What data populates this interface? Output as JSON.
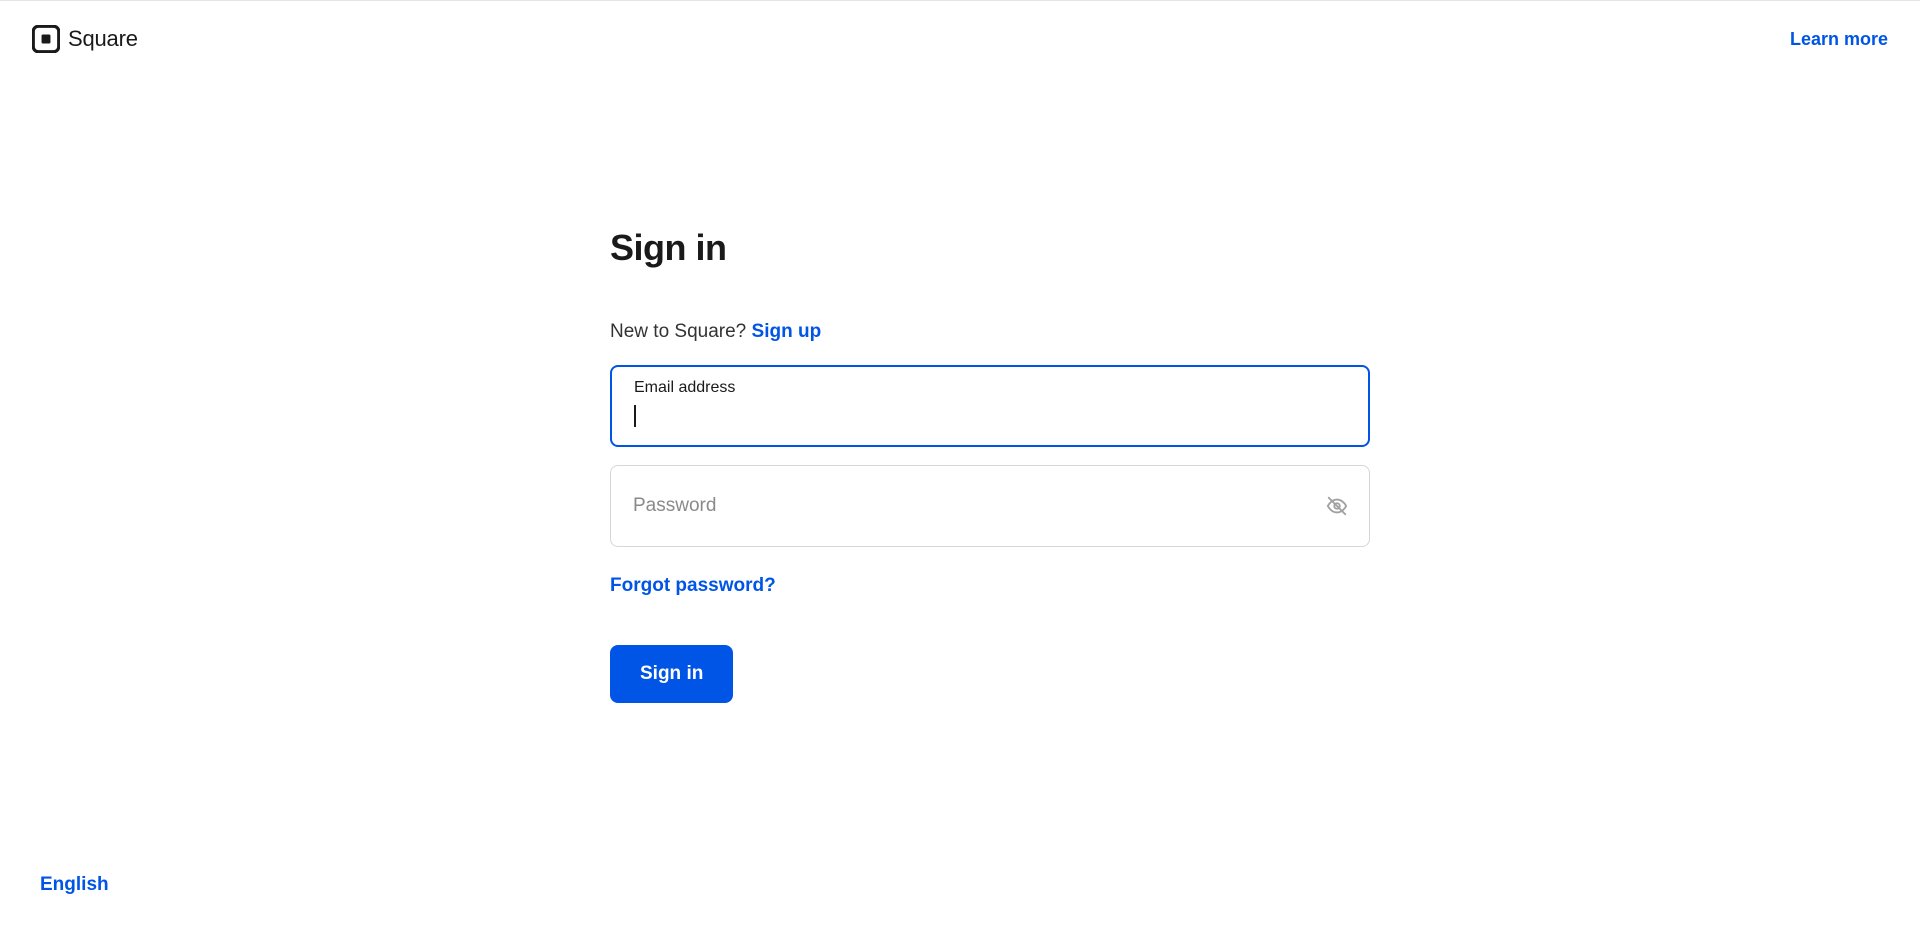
{
  "header": {
    "brand_name": "Square",
    "learn_more": "Learn more"
  },
  "signin": {
    "title": "Sign in",
    "new_prompt": "New to Square? ",
    "signup_link": "Sign up",
    "email_label": "Email address",
    "email_value": "",
    "password_placeholder": "Password",
    "password_value": "",
    "forgot_link": "Forgot password?",
    "submit_label": "Sign in"
  },
  "footer": {
    "language": "English"
  },
  "colors": {
    "accent": "#0055e6"
  }
}
